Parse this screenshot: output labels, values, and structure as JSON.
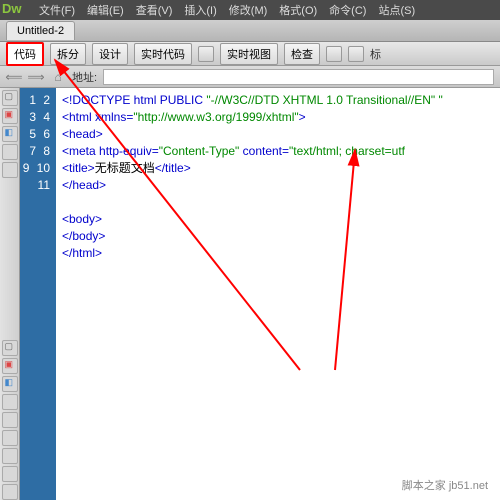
{
  "logo": "Dw",
  "menu": [
    "文件(F)",
    "编辑(E)",
    "查看(V)",
    "插入(I)",
    "修改(M)",
    "格式(O)",
    "命令(C)",
    "站点(S)"
  ],
  "tab_title": "Untitled-2",
  "toolbar": {
    "code": "代码",
    "split": "拆分",
    "design": "设计",
    "livecode": "实时代码",
    "liveview": "实时视图",
    "inspect": "检查",
    "label_right": "标"
  },
  "address": {
    "label": "地址:"
  },
  "lines": [
    "1",
    "2",
    "3",
    "4",
    "5",
    "6",
    "7",
    "8",
    "9",
    "10",
    "11"
  ],
  "code": {
    "l1a": "<!DOCTYPE html PUBLIC ",
    "l1b": "\"-//W3C//DTD XHTML 1.0 Transitional//EN\" \"",
    "l2a": "<html ",
    "l2b": "xmlns=",
    "l2c": "\"http://www.w3.org/1999/xhtml\"",
    "l2d": ">",
    "l3": "<head>",
    "l4a": "<meta ",
    "l4b": "http-equiv=",
    "l4c": "\"Content-Type\"",
    "l4d": " content=",
    "l4e": "\"text/html; charset=utf",
    "l5a": "<title>",
    "l5b": "无标题文档",
    "l5c": "</title>",
    "l6": "</head>",
    "l8": "<body>",
    "l9": "</body>",
    "l10": "</html>"
  },
  "watermark": "脚本之家 jb51.net"
}
